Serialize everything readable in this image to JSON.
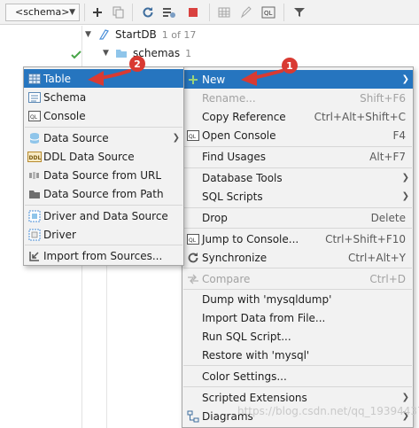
{
  "toolbar": {
    "schema_label": "<schema>",
    "icons": [
      "add-icon",
      "duplicate-icon",
      "refresh-icon",
      "schema-settings-icon",
      "stop-icon",
      "table-view-icon",
      "edit-icon",
      "query-console-icon",
      "filter-icon"
    ]
  },
  "tree": {
    "root_label": "StartDB",
    "root_count": "1 of 17",
    "child_label": "schemas",
    "child_count": "1"
  },
  "main_menu": {
    "items": [
      {
        "label": "New",
        "icon": "plus-icon"
      },
      {
        "label": "Rename...",
        "shortcut": "Shift+F6"
      },
      {
        "label": "Copy Reference",
        "shortcut": "Ctrl+Alt+Shift+C"
      },
      {
        "label": "Open Console",
        "shortcut": "F4",
        "icon": "console-icon"
      },
      {
        "label": "Find Usages",
        "shortcut": "Alt+F7"
      },
      {
        "label": "Database Tools"
      },
      {
        "label": "SQL Scripts"
      },
      {
        "label": "Drop",
        "shortcut": "Delete"
      },
      {
        "label": "Jump to Console...",
        "shortcut": "Ctrl+Shift+F10",
        "icon": "console-icon"
      },
      {
        "label": "Synchronize",
        "shortcut": "Ctrl+Alt+Y",
        "icon": "sync-icon"
      },
      {
        "label": "Compare",
        "shortcut": "Ctrl+D",
        "icon": "compare-icon"
      },
      {
        "label": "Dump with 'mysqldump'"
      },
      {
        "label": "Import Data from File..."
      },
      {
        "label": "Run SQL Script..."
      },
      {
        "label": "Restore with 'mysql'"
      },
      {
        "label": "Color Settings..."
      },
      {
        "label": "Scripted Extensions"
      },
      {
        "label": "Diagrams",
        "icon": "diagram-icon"
      }
    ]
  },
  "sub_menu": {
    "items": [
      {
        "label": "Table",
        "icon": "table-icon"
      },
      {
        "label": "Schema",
        "icon": "schema-icon"
      },
      {
        "label": "Console",
        "icon": "console-icon"
      },
      {
        "label": "Data Source",
        "icon": "datasource-icon"
      },
      {
        "label": "DDL Data Source",
        "icon": "ddl-icon"
      },
      {
        "label": "Data Source from URL",
        "icon": "url-icon"
      },
      {
        "label": "Data Source from Path",
        "icon": "folder-icon"
      },
      {
        "label": "Driver and Data Source",
        "icon": "driver-datasource-icon"
      },
      {
        "label": "Driver",
        "icon": "driver-icon"
      },
      {
        "label": "Import from Sources...",
        "icon": "import-icon"
      }
    ]
  },
  "callouts": {
    "one": "1",
    "two": "2"
  },
  "watermark": "https://blog.csdn.net/qq_19394437",
  "colors": {
    "selection": "#2675bf",
    "callout": "#d93a32",
    "menu_bg": "#f2f2f2"
  }
}
